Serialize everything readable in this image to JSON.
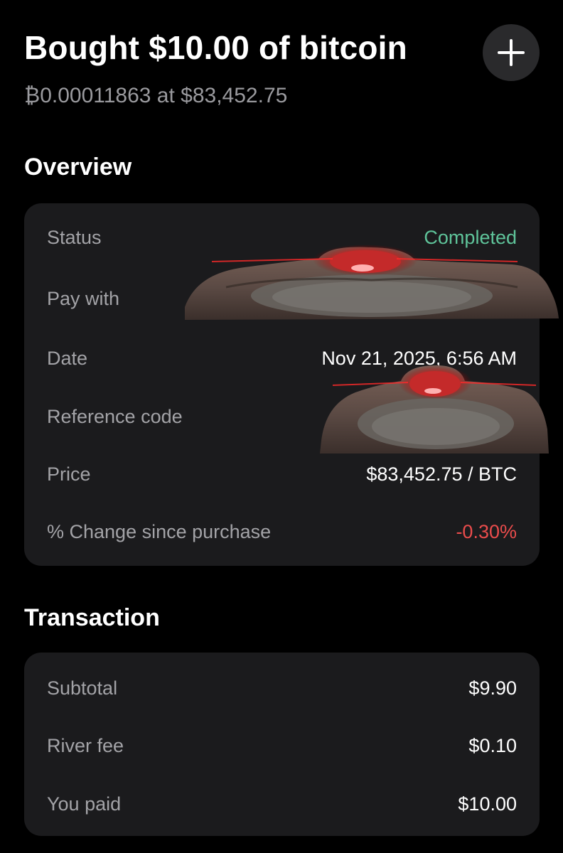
{
  "header": {
    "title": "Bought $10.00 of bitcoin",
    "subtitle": "₿0.00011863 at $83,452.75",
    "add_icon": "plus-icon"
  },
  "overview": {
    "heading": "Overview",
    "rows": [
      {
        "label": "Status",
        "value": "Completed"
      },
      {
        "label": "Pay with",
        "value": ""
      },
      {
        "label": "Date",
        "value": "Nov 21, 2025, 6:56 AM"
      },
      {
        "label": "Reference code",
        "value": ""
      },
      {
        "label": "Price",
        "value": "$83,452.75 / BTC"
      },
      {
        "label": "% Change since purchase",
        "value": "-0.30%"
      }
    ]
  },
  "transaction": {
    "heading": "Transaction",
    "rows": [
      {
        "label": "Subtotal",
        "value": "$9.90"
      },
      {
        "label": "River fee",
        "value": "$0.10"
      },
      {
        "label": "You paid",
        "value": "$10.00"
      }
    ]
  },
  "colors": {
    "background": "#000000",
    "card": "#1b1b1d",
    "status_completed": "#5fc49a",
    "negative_change": "#ea4c4c",
    "muted_text": "#a3a3a7"
  },
  "overlays": [
    "monkey-sticker-image",
    "monkey-sticker-image"
  ]
}
